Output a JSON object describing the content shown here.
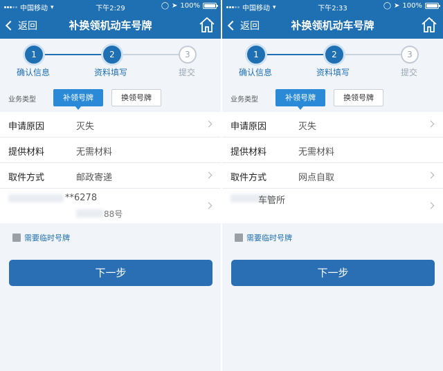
{
  "screens": [
    {
      "status": {
        "carrier": "中国移动",
        "time": "下午2:29",
        "battery": "100%"
      },
      "nav": {
        "back": "返回",
        "title": "补换领机动车号牌"
      },
      "steps": [
        {
          "num": "1",
          "label": "确认信息",
          "active": true
        },
        {
          "num": "2",
          "label": "资料填写",
          "active": true
        },
        {
          "num": "3",
          "label": "提交",
          "active": false
        }
      ],
      "business_type": {
        "label": "业务类型",
        "options": [
          "补领号牌",
          "换领号牌"
        ],
        "selected": "补领号牌"
      },
      "form": [
        {
          "key": "申请原因",
          "value": "灭失",
          "arrow": true
        },
        {
          "key": "提供材料",
          "value": "无需材料",
          "arrow": false
        },
        {
          "key": "取件方式",
          "value": "邮政寄递",
          "arrow": true
        }
      ],
      "address": {
        "line1": "**6278",
        "line2": "88号"
      },
      "temp_plate": "需要临时号牌",
      "next_button": "下一步"
    },
    {
      "status": {
        "carrier": "中国移动",
        "time": "下午2:33",
        "battery": "100%"
      },
      "nav": {
        "back": "返回",
        "title": "补换领机动车号牌"
      },
      "steps": [
        {
          "num": "1",
          "label": "确认信息",
          "active": true
        },
        {
          "num": "2",
          "label": "资料填写",
          "active": true
        },
        {
          "num": "3",
          "label": "提交",
          "active": false
        }
      ],
      "business_type": {
        "label": "业务类型",
        "options": [
          "补领号牌",
          "换领号牌"
        ],
        "selected": "补领号牌"
      },
      "form": [
        {
          "key": "申请原因",
          "value": "灭失",
          "arrow": true
        },
        {
          "key": "提供材料",
          "value": "无需材料",
          "arrow": false
        },
        {
          "key": "取件方式",
          "value": "网点自取",
          "arrow": true
        }
      ],
      "address": {
        "line1": "车管所",
        "line2": ""
      },
      "temp_plate": "需要临时号牌",
      "next_button": "下一步"
    }
  ]
}
